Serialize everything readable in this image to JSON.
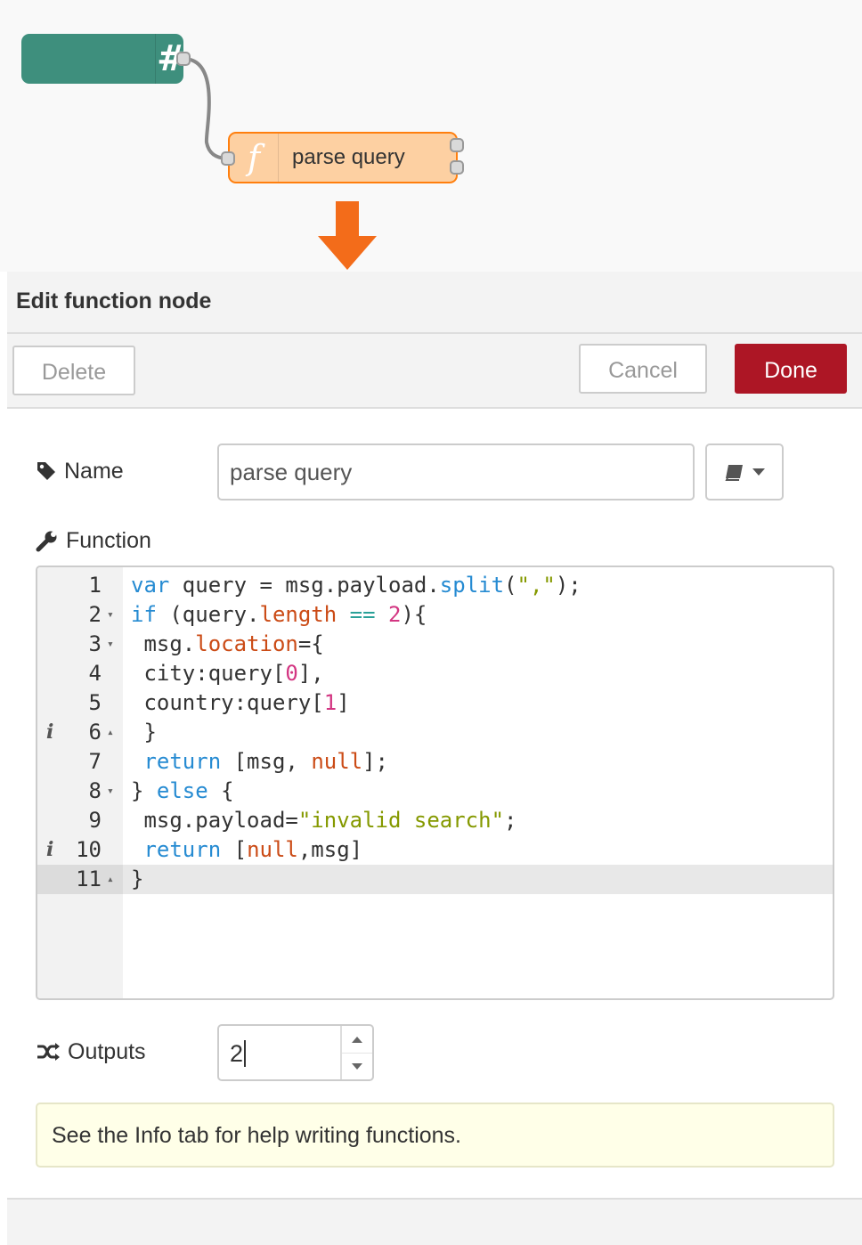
{
  "flow": {
    "inject_node": {
      "icon": "hash-icon",
      "glyph": "#"
    },
    "function_node": {
      "icon": "function-icon",
      "glyph": "f",
      "label": "parse query"
    }
  },
  "tray": {
    "title": "Edit function node",
    "buttons": {
      "delete": "Delete",
      "cancel": "Cancel",
      "done": "Done"
    }
  },
  "form": {
    "name": {
      "label": "Name",
      "value": "parse query",
      "icon": "tag-icon"
    },
    "function": {
      "label": "Function",
      "icon": "wrench-icon"
    },
    "outputs": {
      "label": "Outputs",
      "value": "2",
      "icon": "shuffle-icon"
    },
    "tip": "See the Info tab for help writing functions."
  },
  "editor": {
    "lines": [
      {
        "n": "1",
        "code": "var query = msg.payload.split(\",\");",
        "fold": "",
        "info": ""
      },
      {
        "n": "2",
        "code": "if (query.length == 2){",
        "fold": "down",
        "info": ""
      },
      {
        "n": "3",
        "code": " msg.location={",
        "fold": "down",
        "info": ""
      },
      {
        "n": "4",
        "code": " city:query[0],",
        "fold": "",
        "info": ""
      },
      {
        "n": "5",
        "code": " country:query[1]",
        "fold": "",
        "info": ""
      },
      {
        "n": "6",
        "code": " }",
        "fold": "up",
        "info": "i"
      },
      {
        "n": "7",
        "code": " return [msg, null];",
        "fold": "",
        "info": ""
      },
      {
        "n": "8",
        "code": "} else {",
        "fold": "down",
        "info": ""
      },
      {
        "n": "9",
        "code": " msg.payload=\"invalid search\";",
        "fold": "",
        "info": ""
      },
      {
        "n": "10",
        "code": " return [null,msg]",
        "fold": "",
        "info": "i"
      },
      {
        "n": "11",
        "code": "}",
        "fold": "up",
        "info": ""
      }
    ],
    "active_line": 11
  },
  "colors": {
    "inject": "#3e8f7d",
    "function_fill": "#fdd0a2",
    "function_border": "#ff7f0e",
    "arrow": "#f36c1a",
    "done_button": "#ad1625",
    "tip_background": "#ffffe8"
  }
}
